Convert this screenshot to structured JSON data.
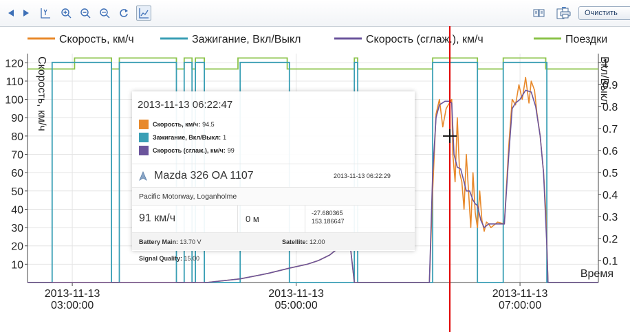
{
  "toolbar": {
    "clear_label": "Очистить"
  },
  "chart_data": {
    "type": "line",
    "title": "",
    "xlabel": "Время",
    "ylabel_left": "Скорость, км/ч",
    "ylabel_right": "Вкл/Выкл",
    "ylim_left": [
      0,
      125
    ],
    "ylim_right": [
      0,
      1.04
    ],
    "y_ticks_left": [
      10,
      20,
      30,
      40,
      50,
      60,
      70,
      80,
      90,
      100,
      110,
      120
    ],
    "y_tick_labels_left": [
      "10",
      "20",
      "30",
      "40",
      "50",
      "60",
      "70",
      "80",
      "90",
      "100",
      "110",
      "120"
    ],
    "y_ticks_right": [
      0.1,
      0.2,
      0.3,
      0.4,
      0.5,
      0.6,
      0.7,
      0.8,
      0.9,
      1
    ],
    "y_tick_labels_right": [
      "0.1",
      "0.2",
      "0.3",
      "0.4",
      "0.5",
      "0.6",
      "0.7",
      "0.8",
      "0.9",
      "1"
    ],
    "x_range_hours": [
      2.6,
      7.7
    ],
    "x_ticks": [
      {
        "at_hour": 3,
        "line1": "2013-11-13",
        "line2": "03:00:00"
      },
      {
        "at_hour": 5,
        "line1": "2013-11-13",
        "line2": "05:00:00"
      },
      {
        "at_hour": 7,
        "line1": "2013-11-13",
        "line2": "07:00:00"
      }
    ],
    "grid": true,
    "legend_position": "top",
    "cursor_hour": 6.373,
    "series": [
      {
        "name": "Скорость, км/ч",
        "color": "#e8892b",
        "axis": "left",
        "points": [
          [
            2.6,
            0
          ],
          [
            4.2,
            0
          ],
          [
            4.5,
            2
          ],
          [
            4.75,
            5
          ],
          [
            4.95,
            8
          ],
          [
            5.1,
            10
          ],
          [
            5.2,
            12
          ],
          [
            5.3,
            15
          ],
          [
            5.4,
            20
          ],
          [
            5.48,
            22
          ],
          [
            5.52,
            0
          ],
          [
            5.65,
            0
          ],
          [
            5.82,
            0
          ],
          [
            6.0,
            0
          ],
          [
            6.19,
            0
          ],
          [
            6.22,
            50
          ],
          [
            6.25,
            92
          ],
          [
            6.28,
            100
          ],
          [
            6.31,
            85
          ],
          [
            6.34,
            95
          ],
          [
            6.37,
            98
          ],
          [
            6.39,
            100
          ],
          [
            6.4,
            70
          ],
          [
            6.42,
            55
          ],
          [
            6.44,
            90
          ],
          [
            6.46,
            60
          ],
          [
            6.48,
            55
          ],
          [
            6.5,
            40
          ],
          [
            6.52,
            70
          ],
          [
            6.54,
            50
          ],
          [
            6.56,
            30
          ],
          [
            6.58,
            60
          ],
          [
            6.6,
            38
          ],
          [
            6.62,
            30
          ],
          [
            6.64,
            50
          ],
          [
            6.66,
            34
          ],
          [
            6.68,
            28
          ],
          [
            6.7,
            33
          ],
          [
            6.72,
            32
          ],
          [
            6.74,
            30
          ],
          [
            6.8,
            33
          ],
          [
            6.86,
            32
          ],
          [
            6.9,
            75
          ],
          [
            6.93,
            100
          ],
          [
            6.96,
            97
          ],
          [
            6.99,
            108
          ],
          [
            7.02,
            100
          ],
          [
            7.05,
            112
          ],
          [
            7.08,
            98
          ],
          [
            7.1,
            110
          ],
          [
            7.13,
            105
          ],
          [
            7.15,
            93
          ],
          [
            7.18,
            80
          ],
          [
            7.21,
            60
          ],
          [
            7.23,
            40
          ],
          [
            7.25,
            0
          ],
          [
            7.7,
            0
          ]
        ]
      },
      {
        "name": "Зажигание, Вкл/Выкл",
        "color": "#3a9fb5",
        "axis": "right",
        "steps": [
          [
            2.6,
            0
          ],
          [
            2.82,
            1
          ],
          [
            3.35,
            0
          ],
          [
            3.42,
            1
          ],
          [
            3.93,
            0
          ],
          [
            4.0,
            1
          ],
          [
            4.07,
            0
          ],
          [
            4.1,
            1
          ],
          [
            4.18,
            0
          ],
          [
            4.5,
            1
          ],
          [
            4.94,
            0
          ],
          [
            5.52,
            1
          ],
          [
            5.55,
            0
          ],
          [
            6.22,
            1
          ],
          [
            6.62,
            0
          ],
          [
            6.85,
            1
          ],
          [
            7.24,
            0
          ],
          [
            7.7,
            0
          ]
        ]
      },
      {
        "name": "Скорость (сглаж.), км/ч",
        "color": "#6b559c",
        "axis": "left",
        "points": [
          [
            2.6,
            0
          ],
          [
            4.2,
            0
          ],
          [
            4.5,
            2
          ],
          [
            4.75,
            5
          ],
          [
            4.95,
            8
          ],
          [
            5.1,
            10
          ],
          [
            5.2,
            12
          ],
          [
            5.3,
            15
          ],
          [
            5.4,
            20
          ],
          [
            5.48,
            22
          ],
          [
            5.52,
            0
          ],
          [
            6.19,
            0
          ],
          [
            6.22,
            60
          ],
          [
            6.25,
            90
          ],
          [
            6.28,
            97
          ],
          [
            6.33,
            99
          ],
          [
            6.37,
            99
          ],
          [
            6.39,
            98
          ],
          [
            6.41,
            70
          ],
          [
            6.44,
            63
          ],
          [
            6.47,
            62
          ],
          [
            6.5,
            55
          ],
          [
            6.52,
            50
          ],
          [
            6.55,
            50
          ],
          [
            6.58,
            45
          ],
          [
            6.6,
            43
          ],
          [
            6.62,
            42
          ],
          [
            6.65,
            34
          ],
          [
            6.68,
            30
          ],
          [
            6.72,
            32
          ],
          [
            6.86,
            32
          ],
          [
            6.9,
            70
          ],
          [
            6.93,
            95
          ],
          [
            6.96,
            98
          ],
          [
            7.0,
            100
          ],
          [
            7.05,
            105
          ],
          [
            7.1,
            104
          ],
          [
            7.14,
            96
          ],
          [
            7.18,
            80
          ],
          [
            7.21,
            60
          ],
          [
            7.24,
            20
          ],
          [
            7.25,
            0
          ],
          [
            7.7,
            0
          ]
        ]
      },
      {
        "name": "Поездки",
        "color": "#8bc34a",
        "axis": "right",
        "steps": [
          [
            2.6,
            0.97
          ],
          [
            3.02,
            1.02
          ],
          [
            3.35,
            0.97
          ],
          [
            3.42,
            1.02
          ],
          [
            3.93,
            0.97
          ],
          [
            4.0,
            1.02
          ],
          [
            4.07,
            0.97
          ],
          [
            4.1,
            1.02
          ],
          [
            4.18,
            0.97
          ],
          [
            4.48,
            1.02
          ],
          [
            4.92,
            0.97
          ],
          [
            5.52,
            1.02
          ],
          [
            5.55,
            0.97
          ],
          [
            6.22,
            1.02
          ],
          [
            6.62,
            0.97
          ],
          [
            6.85,
            1.02
          ],
          [
            7.23,
            0.97
          ],
          [
            7.7,
            0.97
          ]
        ]
      }
    ]
  },
  "tooltip": {
    "time": "2013-11-13 06:22:47",
    "rows": [
      {
        "label": "Скорость, км/ч:",
        "value": "94.5",
        "color": "#e8892b"
      },
      {
        "label": "Зажигание, Вкл/Выкл:",
        "value": "1",
        "color": "#3a9fb5"
      },
      {
        "label": "Скорость (сглаж.), км/ч:",
        "value": "99",
        "color": "#6b559c"
      }
    ],
    "vehicle": "Mazda 326 OA 1107",
    "vehicle_time": "2013-11-13 06:22:29",
    "address": "Pacific Motorway, Loganholme",
    "speed": "91 км/ч",
    "distance": "0 м",
    "lat": "-27.680365",
    "lng": "153.186647",
    "battery_label": "Battery Main:",
    "battery_value": "13.70 V",
    "satellite_label": "Satellite:",
    "satellite_value": "12.00",
    "signal_label": "Signal Quality:",
    "signal_value": "15.00"
  }
}
